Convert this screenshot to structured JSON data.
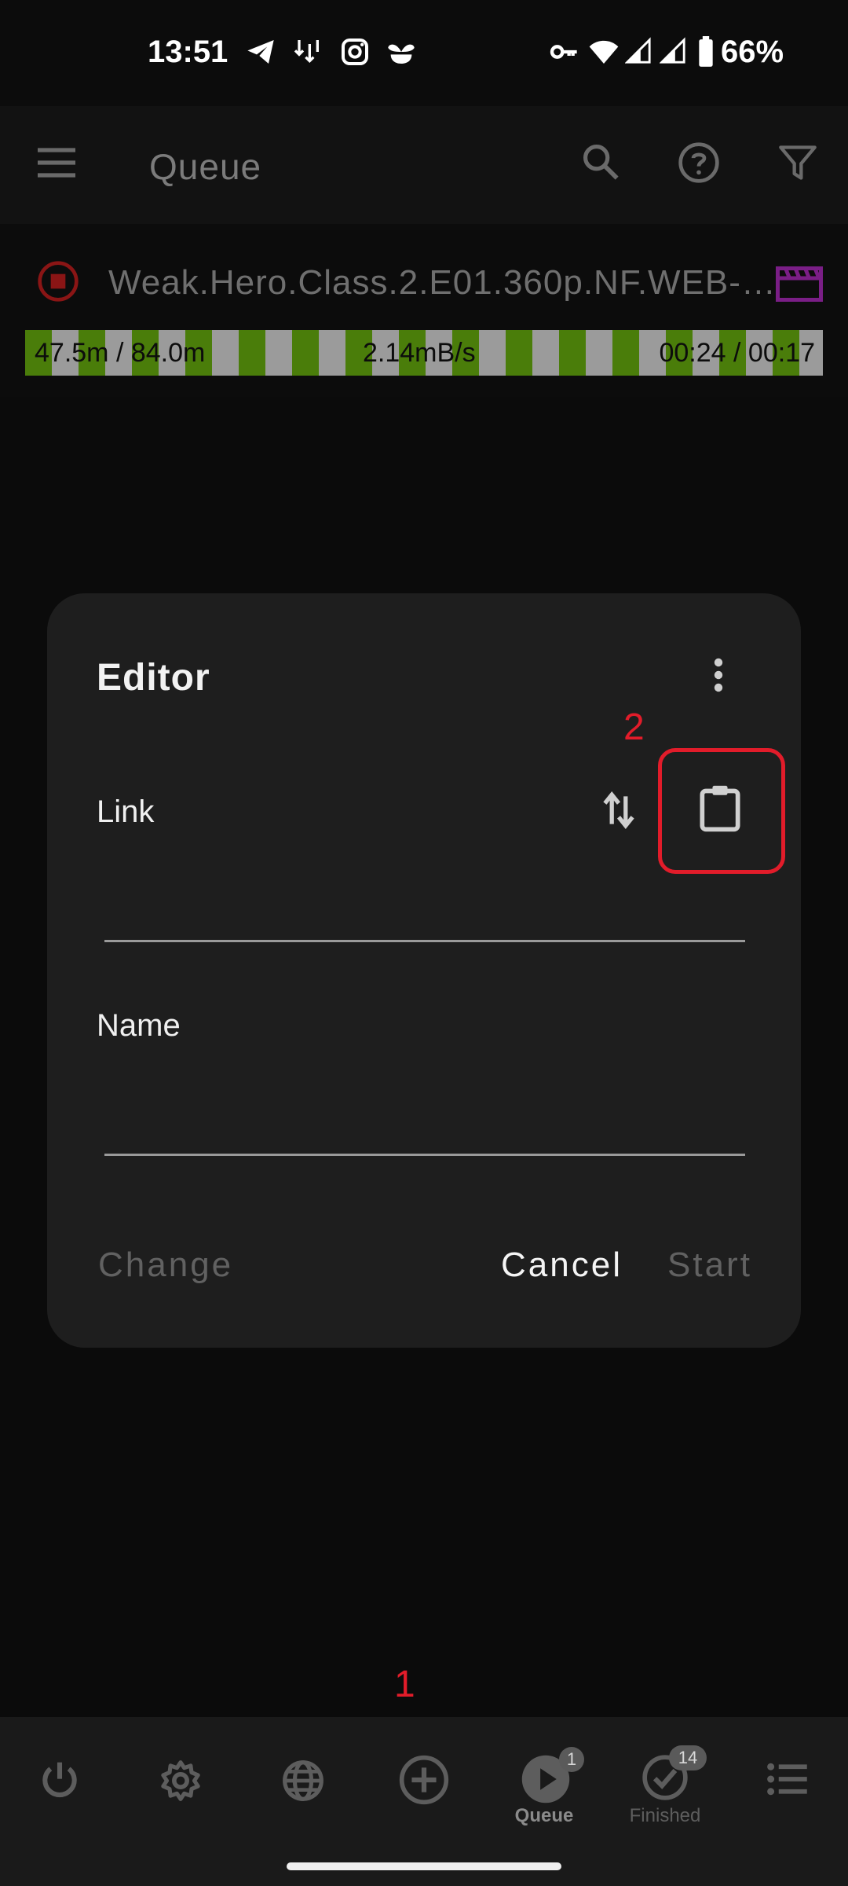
{
  "status_bar": {
    "time": "13:51",
    "battery": "66%",
    "icons": [
      "telegram-icon",
      "download-icon",
      "instagram-icon",
      "plant-icon",
      "vpn-key-icon",
      "wifi-icon",
      "signal-icon",
      "signal-icon",
      "battery-icon"
    ]
  },
  "app_bar": {
    "title": "Queue",
    "icons": [
      "menu-icon",
      "search-icon",
      "help-icon",
      "filter-icon"
    ]
  },
  "queue_item": {
    "title": "Weak.Hero.Class.2.E01.360p.NF.WEB-…",
    "size": "47.5m / 84.0m",
    "speed": "2.14mB/s",
    "time": "00:24 / 00:17",
    "progress": 0.565
  },
  "dialog": {
    "title": "Editor",
    "link_label": "Link",
    "name_label": "Name",
    "link_value": "",
    "name_value": "",
    "change_label": "Change",
    "cancel_label": "Cancel",
    "start_label": "Start"
  },
  "annotations": {
    "step1": "1",
    "step2": "2"
  },
  "bottom_nav": {
    "items": [
      {
        "icon": "power-icon",
        "label": ""
      },
      {
        "icon": "settings-icon",
        "label": ""
      },
      {
        "icon": "globe-icon",
        "label": ""
      },
      {
        "icon": "add-circle-icon",
        "label": ""
      },
      {
        "icon": "play-circle-icon",
        "label": "Queue",
        "badge": "1"
      },
      {
        "icon": "check-circle-icon",
        "label": "Finished",
        "badge": "14"
      },
      {
        "icon": "list-icon",
        "label": ""
      }
    ]
  },
  "colors": {
    "accent_annotation": "#e21c2a",
    "progress_green": "#4a7d0a",
    "progress_gray": "#9b9b9b",
    "item_purple": "#7a1e86",
    "stop_red": "#8a1515"
  }
}
